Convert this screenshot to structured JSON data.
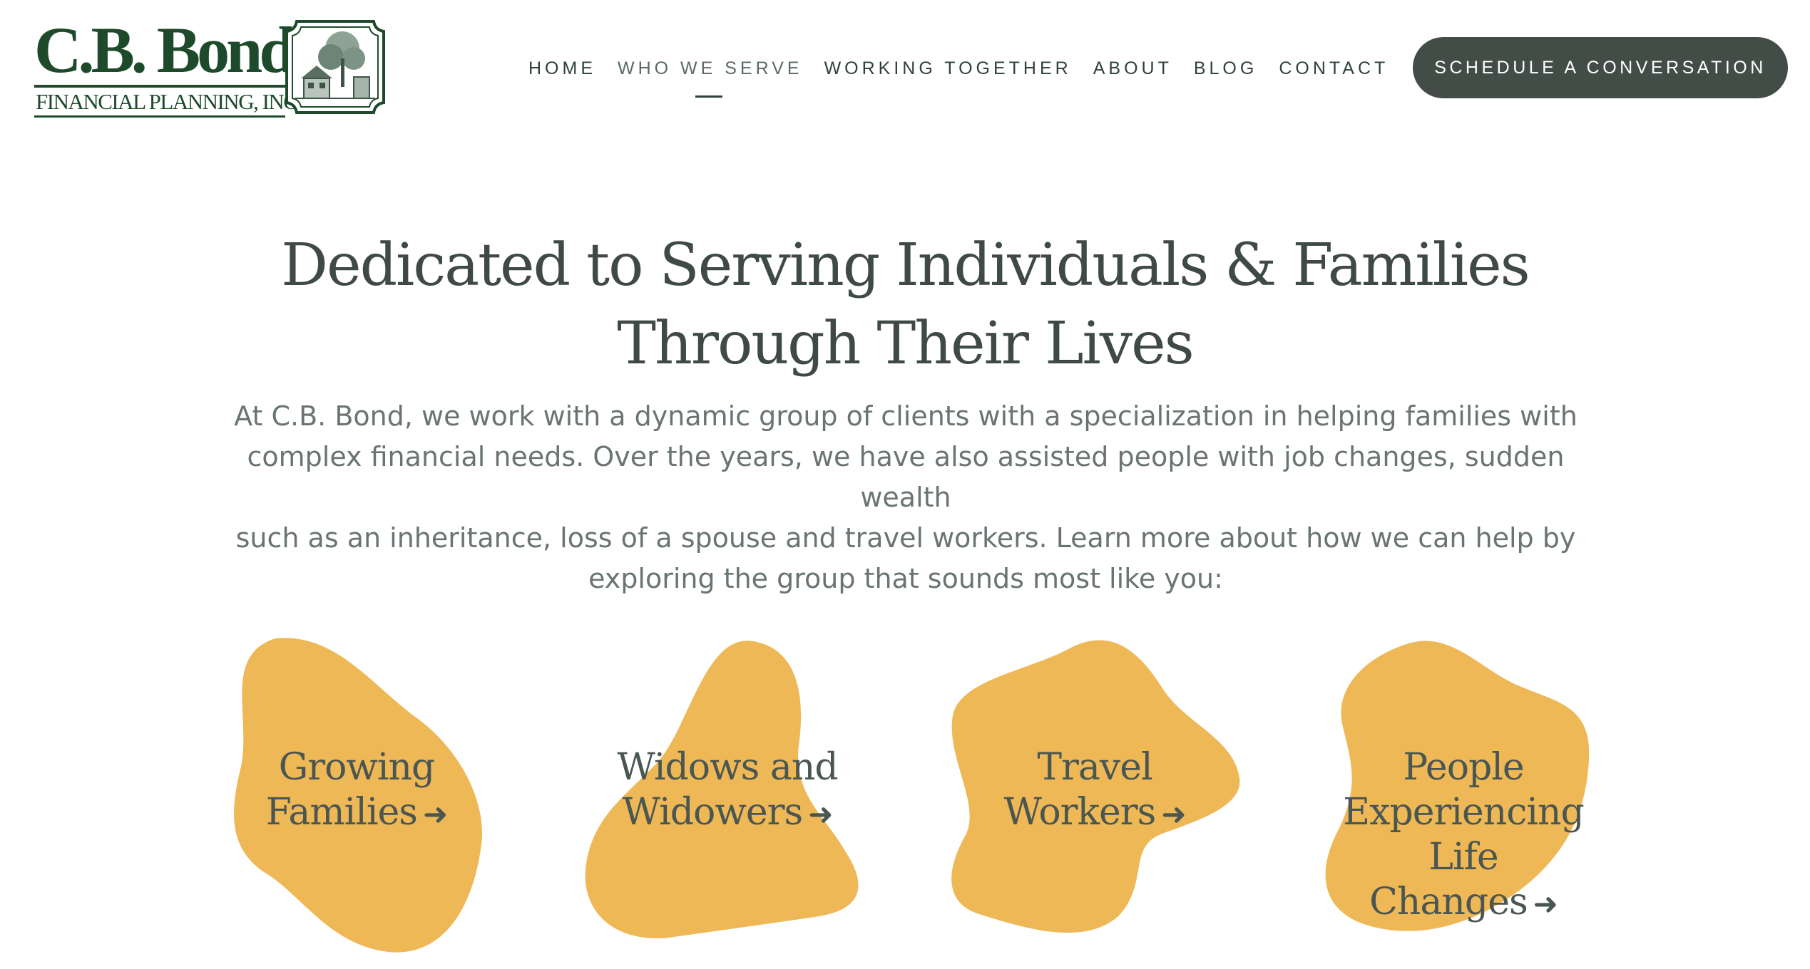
{
  "logo": {
    "name": "C.B. Bond",
    "subtitle": "FINANCIAL PLANNING, INC."
  },
  "nav": {
    "items": [
      {
        "label": "HOME"
      },
      {
        "label": "WHO WE SERVE",
        "active": true
      },
      {
        "label": "WORKING TOGETHER"
      },
      {
        "label": "ABOUT"
      },
      {
        "label": "BLOG"
      },
      {
        "label": "CONTACT"
      }
    ],
    "cta_label": "SCHEDULE A CONVERSATION"
  },
  "hero": {
    "title_line1": "Dedicated to Serving Individuals & Families",
    "title_line2": "Through Their Lives",
    "text_line1": "At C.B. Bond, we work with a dynamic group of clients with a specialization in helping families with",
    "text_line2": "complex financial needs. Over the years, we have also assisted people with job changes, sudden wealth",
    "text_line3": "such as an inheritance, loss of a spouse and travel workers. Learn more about how we can help by",
    "text_line4": "exploring the group that sounds most like you:"
  },
  "groups": [
    {
      "line1": "Growing",
      "line2": "Families",
      "arrow": "➜"
    },
    {
      "line1": "Widows and",
      "line2": "Widowers",
      "arrow": "➜"
    },
    {
      "line1": "Travel",
      "line2": "Workers",
      "arrow": "➜"
    },
    {
      "line1": "People",
      "line2": "Experiencing Life",
      "line3": "Changes",
      "arrow": "➜"
    }
  ],
  "colors": {
    "brand_green": "#1d4a2b",
    "text_dark": "#3f4a45",
    "text_body": "#6a7570",
    "cta_bg": "#434d48",
    "blob_yellow": "#efb856"
  }
}
